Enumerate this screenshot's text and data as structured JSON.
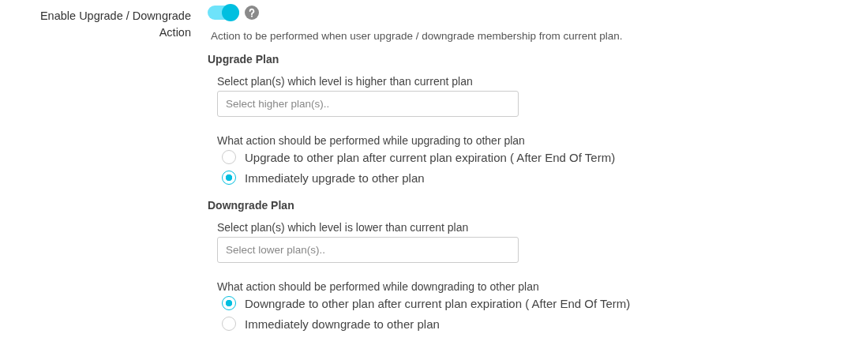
{
  "setting": {
    "label": "Enable Upgrade / Downgrade Action",
    "toggle": {
      "on": true
    },
    "description": "Action to be performed when user upgrade / downgrade membership from current plan."
  },
  "sections": [
    {
      "title": "Upgrade Plan",
      "field_label": "Select plan(s) which level is higher than current plan",
      "placeholder": "Select higher plan(s)..",
      "question": "What action should be performed while upgrading to other plan",
      "options": [
        {
          "label": "Upgrade to other plan after current plan expiration ( After End Of Term)",
          "selected": false
        },
        {
          "label": "Immediately upgrade to other plan",
          "selected": true
        }
      ]
    },
    {
      "title": "Downgrade Plan",
      "field_label": "Select plan(s) which level is lower than current plan",
      "placeholder": "Select lower plan(s)..",
      "question": "What action should be performed while downgrading to other plan",
      "options": [
        {
          "label": "Downgrade to other plan after current plan expiration ( After End Of Term)",
          "selected": true
        },
        {
          "label": "Immediately downgrade to other plan",
          "selected": false
        }
      ]
    }
  ]
}
